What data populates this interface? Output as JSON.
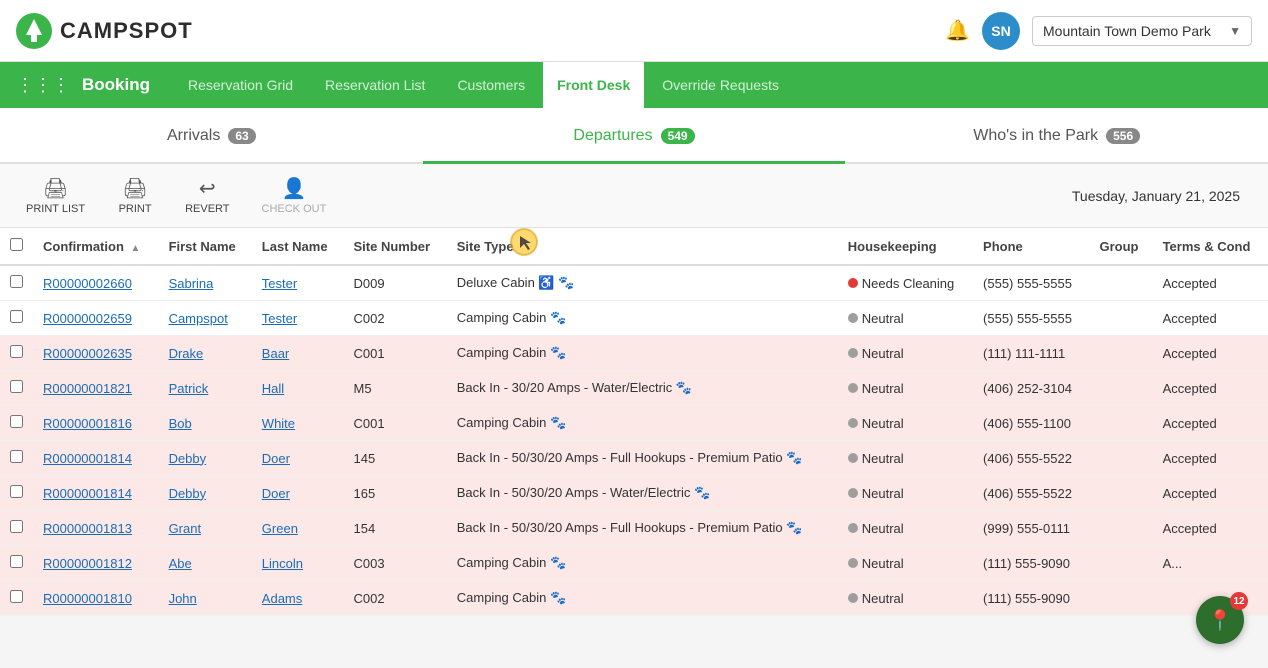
{
  "app": {
    "logo_text": "CAMPSPOT",
    "logo_icon": "🌲"
  },
  "topbar": {
    "bell_label": "notifications",
    "avatar_initials": "SN",
    "park_name": "Mountain Town Demo Park",
    "chevron": "▼"
  },
  "navbar": {
    "brand": "Booking",
    "items": [
      {
        "label": "Reservation Grid",
        "active": false
      },
      {
        "label": "Reservation List",
        "active": false
      },
      {
        "label": "Customers",
        "active": false
      },
      {
        "label": "Front Desk",
        "active": true
      },
      {
        "label": "Override Requests",
        "active": false
      }
    ]
  },
  "tabs": [
    {
      "label": "Arrivals",
      "badge": "63",
      "active": false
    },
    {
      "label": "Departures",
      "badge": "549",
      "active": true
    },
    {
      "label": "Who's in the Park",
      "badge": "556",
      "active": false
    }
  ],
  "toolbar": {
    "print_list_label": "PRINT LIST",
    "print_label": "PRINT",
    "revert_label": "REVERT",
    "check_out_label": "CHECK OUT",
    "date": "Tuesday, January 21, 2025"
  },
  "table": {
    "columns": [
      "Confirmation",
      "First Name",
      "Last Name",
      "Site Number",
      "Site Type",
      "Housekeeping",
      "Phone",
      "Group",
      "Terms & Cond"
    ],
    "rows": [
      {
        "confirmation": "R00000002660",
        "first": "Sabrina",
        "last": "Tester",
        "site": "D009",
        "site_type": "Deluxe Cabin ♿ 🐾",
        "hk_dot": "red",
        "hk": "Needs Cleaning",
        "phone": "(555) 555-5555",
        "group": "",
        "terms": "Accepted",
        "pink": false
      },
      {
        "confirmation": "R00000002659",
        "first": "Campspot",
        "last": "Tester",
        "site": "C002",
        "site_type": "Camping Cabin 🐾",
        "hk_dot": "gray",
        "hk": "Neutral",
        "phone": "(555) 555-5555",
        "group": "",
        "terms": "Accepted",
        "pink": false
      },
      {
        "confirmation": "R00000002635",
        "first": "Drake",
        "last": "Baar",
        "site": "C001",
        "site_type": "Camping Cabin 🐾",
        "hk_dot": "gray",
        "hk": "Neutral",
        "phone": "(111) 111-1111",
        "group": "",
        "terms": "Accepted",
        "pink": true
      },
      {
        "confirmation": "R00000001821",
        "first": "Patrick",
        "last": "Hall",
        "site": "M5",
        "site_type": "Back In - 30/20 Amps - Water/Electric 🐾",
        "hk_dot": "gray",
        "hk": "Neutral",
        "phone": "(406) 252-3104",
        "group": "",
        "terms": "Accepted",
        "pink": true
      },
      {
        "confirmation": "R00000001816",
        "first": "Bob",
        "last": "White",
        "site": "C001",
        "site_type": "Camping Cabin 🐾",
        "hk_dot": "gray",
        "hk": "Neutral",
        "phone": "(406) 555-1100",
        "group": "",
        "terms": "Accepted",
        "pink": true
      },
      {
        "confirmation": "R00000001814",
        "first": "Debby",
        "last": "Doer",
        "site": "145",
        "site_type": "Back In - 50/30/20 Amps - Full Hookups - Premium Patio 🐾",
        "hk_dot": "gray",
        "hk": "Neutral",
        "phone": "(406) 555-5522",
        "group": "",
        "terms": "Accepted",
        "pink": true
      },
      {
        "confirmation": "R00000001814",
        "first": "Debby",
        "last": "Doer",
        "site": "165",
        "site_type": "Back In - 50/30/20 Amps - Water/Electric 🐾",
        "hk_dot": "gray",
        "hk": "Neutral",
        "phone": "(406) 555-5522",
        "group": "",
        "terms": "Accepted",
        "pink": true
      },
      {
        "confirmation": "R00000001813",
        "first": "Grant",
        "last": "Green",
        "site": "154",
        "site_type": "Back In - 50/30/20 Amps - Full Hookups - Premium Patio 🐾",
        "hk_dot": "gray",
        "hk": "Neutral",
        "phone": "(999) 555-0111",
        "group": "",
        "terms": "Accepted",
        "pink": true
      },
      {
        "confirmation": "R00000001812",
        "first": "Abe",
        "last": "Lincoln",
        "site": "C003",
        "site_type": "Camping Cabin 🐾",
        "hk_dot": "gray",
        "hk": "Neutral",
        "phone": "(111) 555-9090",
        "group": "",
        "terms": "A...",
        "pink": true
      },
      {
        "confirmation": "R00000001810",
        "first": "John",
        "last": "Adams",
        "site": "C002",
        "site_type": "Camping Cabin 🐾",
        "hk_dot": "gray",
        "hk": "Neutral",
        "phone": "(111) 555-9090",
        "group": "",
        "terms": "",
        "pink": true
      }
    ]
  },
  "map_pin": {
    "count": "12"
  }
}
